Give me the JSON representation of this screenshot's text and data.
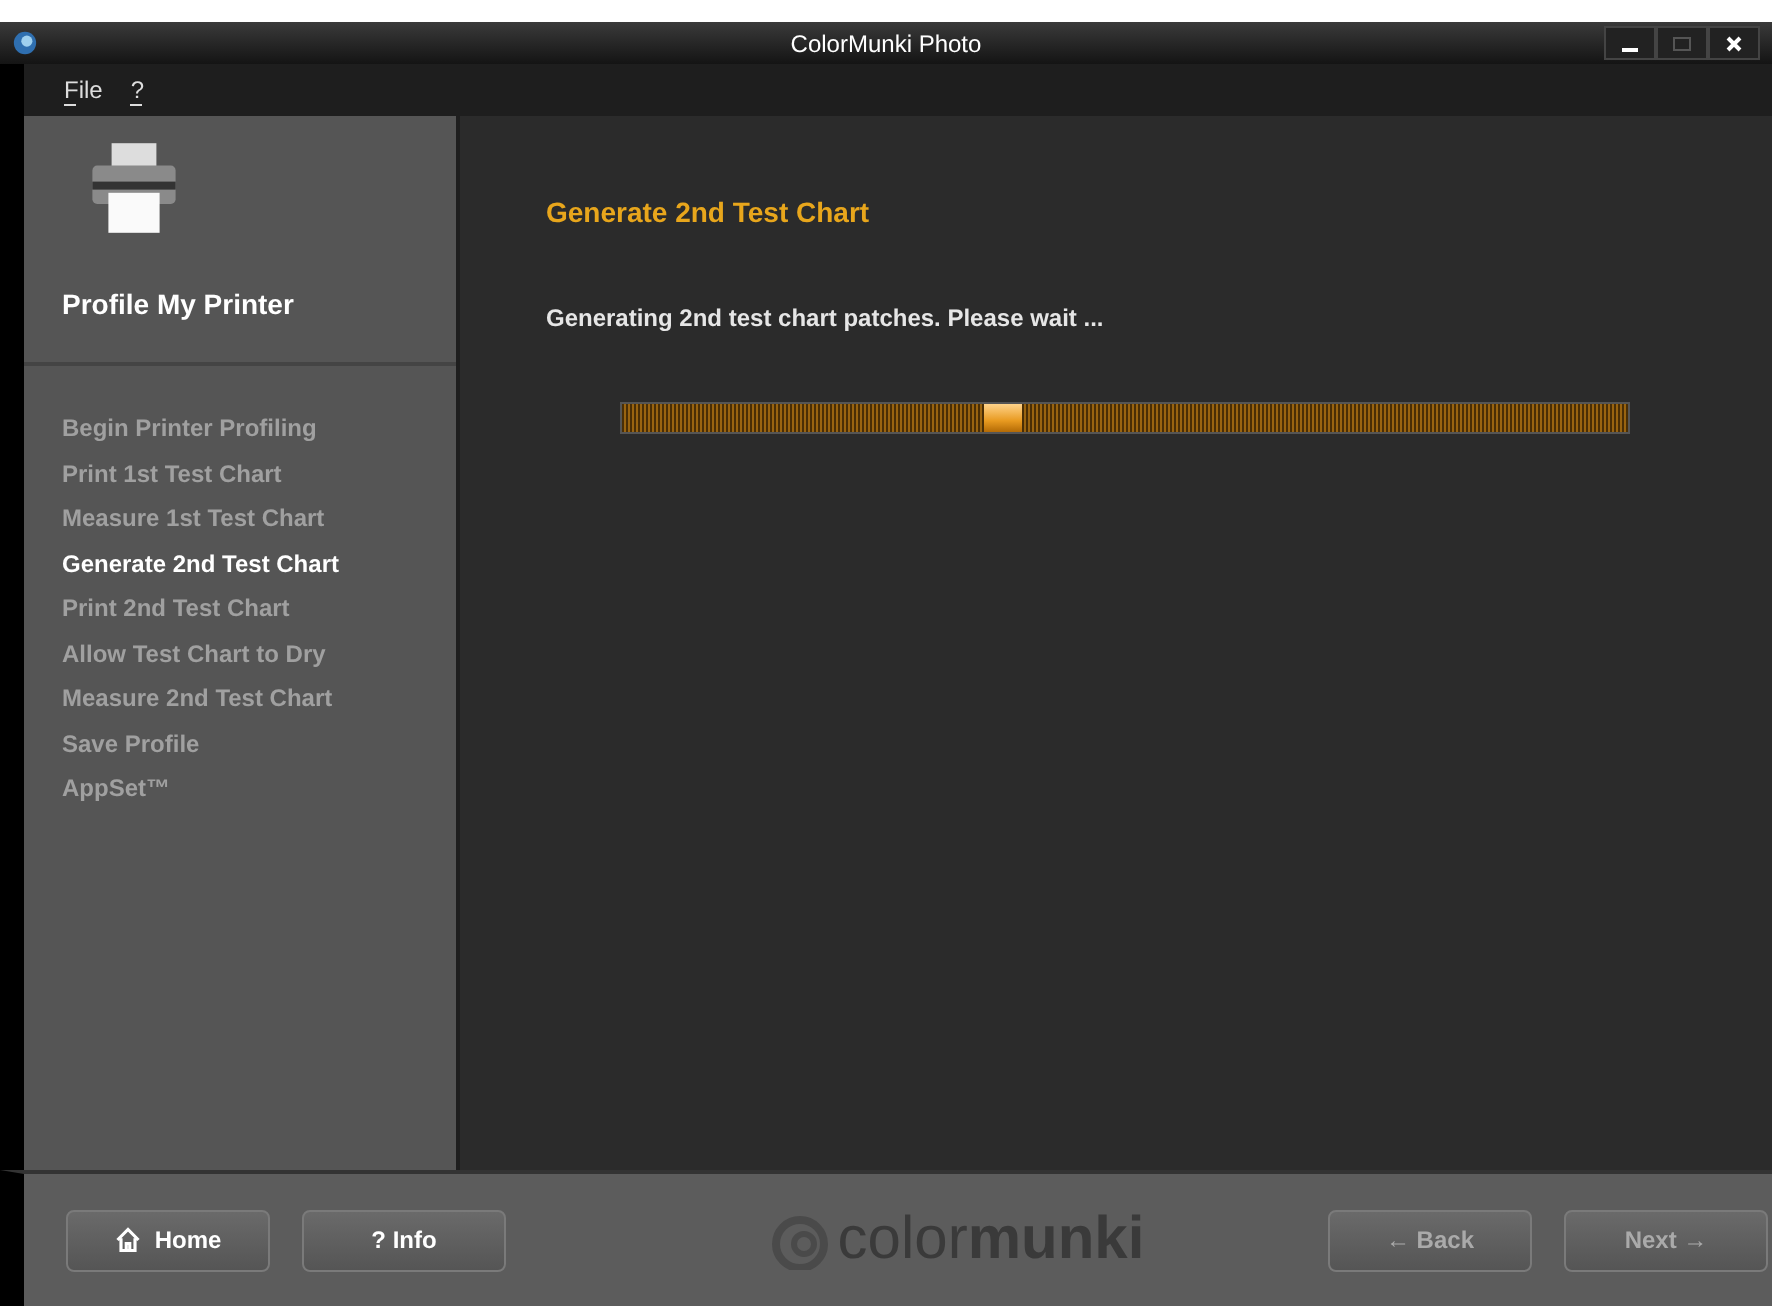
{
  "window": {
    "title": "ColorMunki Photo"
  },
  "menu": [
    {
      "label": "File"
    },
    {
      "label": "?"
    }
  ],
  "sidebar": {
    "title": "Profile My Printer",
    "items": [
      {
        "label": "Begin Printer Profiling",
        "selected": false
      },
      {
        "label": "Print 1st Test Chart",
        "selected": false
      },
      {
        "label": "Measure 1st Test Chart",
        "selected": false
      },
      {
        "label": "Generate 2nd Test Chart",
        "selected": true
      },
      {
        "label": "Print 2nd Test Chart",
        "selected": false
      },
      {
        "label": "Allow Test Chart to Dry",
        "selected": false
      },
      {
        "label": "Measure 2nd Test Chart",
        "selected": false
      },
      {
        "label": "Save Profile",
        "selected": false
      },
      {
        "label": "AppSet™",
        "selected": false
      }
    ]
  },
  "main": {
    "heading": "Generate 2nd Test Chart",
    "message": "Generating 2nd test chart patches. Please wait ...",
    "progress": {
      "level": 0.36
    }
  },
  "footer": {
    "left_buttons": [
      {
        "kind": "home",
        "label": "Home",
        "disabled": false
      },
      {
        "kind": "info",
        "label": "? Info",
        "disabled": false
      }
    ],
    "logo": "color**munki**",
    "right_buttons": [
      {
        "label": "← Back",
        "disabled": true
      },
      {
        "label": "Next →",
        "disabled": true
      }
    ]
  }
}
